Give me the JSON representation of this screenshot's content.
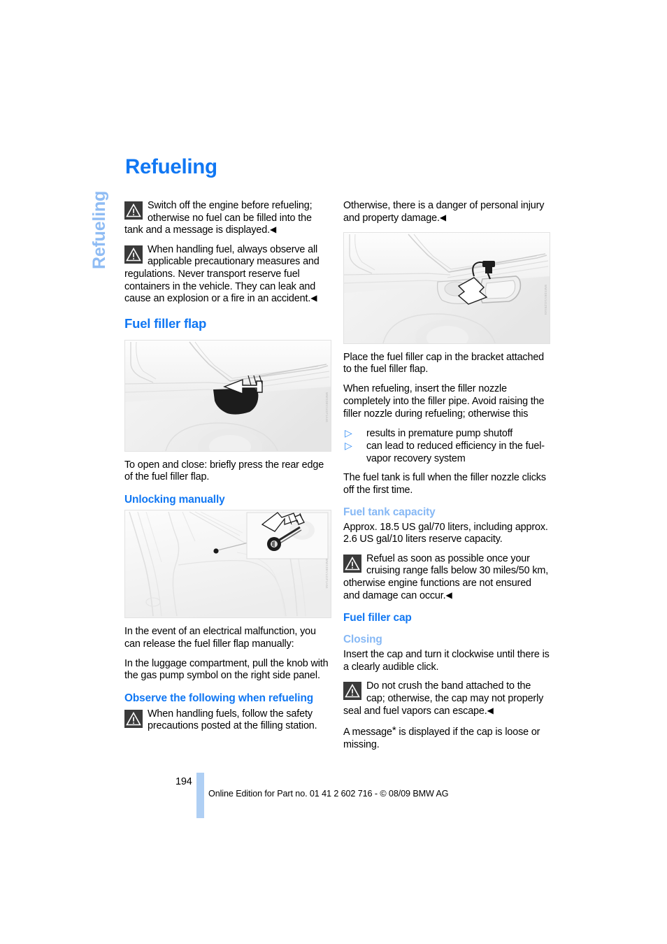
{
  "document": {
    "title": "Refueling",
    "side_tab_label": "Refueling",
    "page_number": "194",
    "footer_text": "Online Edition for Part no. 01 41 2 602 716 - © 08/09 BMW AG",
    "accent_blue": "#1077F3",
    "accent_blue_light": "#86B8F5",
    "side_tab_blue": "#8FBCF4",
    "footer_bar_blue": "#AFCFF4",
    "bullet_blue": "#2F8BF5",
    "warn_icon_bg": "#3A3A3A"
  },
  "left_column": {
    "warning_1": "Switch off the engine before refueling; otherwise no fuel can be filled into the tank and a message is displayed.",
    "warning_2": "When handling fuel, always observe all applicable precautionary measures and regulations. Never transport reserve fuel containers in the vehicle. They can leak and cause an explosion or a fire in an accident.",
    "section_heading": "Fuel filler flap",
    "figure_1_credit": "WWXDEV141F1A46",
    "figure_1_caption": "To open and close: briefly press the rear edge of the fuel filler flap.",
    "sub_heading_1": "Unlocking manually",
    "figure_2_credit": "WWXDEV141F1A54",
    "figure_2_para_1": "In the event of an electrical malfunction, you can release the fuel filler flap manually:",
    "figure_2_para_2": "In the luggage compartment, pull the knob with the gas pump symbol on the right side panel.",
    "sub_heading_2": "Observe the following when refueling",
    "warning_3": "When handling fuels, follow the safety precautions posted at the filling station."
  },
  "right_column": {
    "continuation_text": "Otherwise, there is a danger of personal injury and property damage.",
    "figure_3_credit": "WWXDEV141ZEU46",
    "para_1": "Place the fuel filler cap in the bracket attached to the fuel filler flap.",
    "para_2": "When refueling, insert the filler nozzle completely into the filler pipe. Avoid raising the filler nozzle during refueling; otherwise this",
    "bullets": [
      "results in premature pump shutoff",
      "can lead to reduced efficiency in the fuel-vapor recovery system"
    ],
    "para_3": "The fuel tank is full when the filler nozzle clicks off the first time.",
    "sub_heading_capacity": "Fuel tank capacity",
    "capacity_text": "Approx. 18.5 US gal/70 liters, including approx. 2.6 US gal/10 liters reserve capacity.",
    "warning_4": "Refuel as soon as possible once your cruising range falls below 30 miles/50 km, otherwise engine functions are not ensured and damage can occur.",
    "section_heading_cap": "Fuel filler cap",
    "sub_heading_closing": "Closing",
    "closing_text": "Insert the cap and turn it clockwise until there is a clearly audible click.",
    "warning_5": "Do not crush the band attached to the cap; otherwise, the cap may not properly seal and fuel vapors can escape.",
    "message_text_before": "A message",
    "message_star": "*",
    "message_text_after": " is displayed if the cap is loose or missing."
  },
  "markers": {
    "end_of_note": "◀",
    "bullet_triangle": "▷"
  }
}
